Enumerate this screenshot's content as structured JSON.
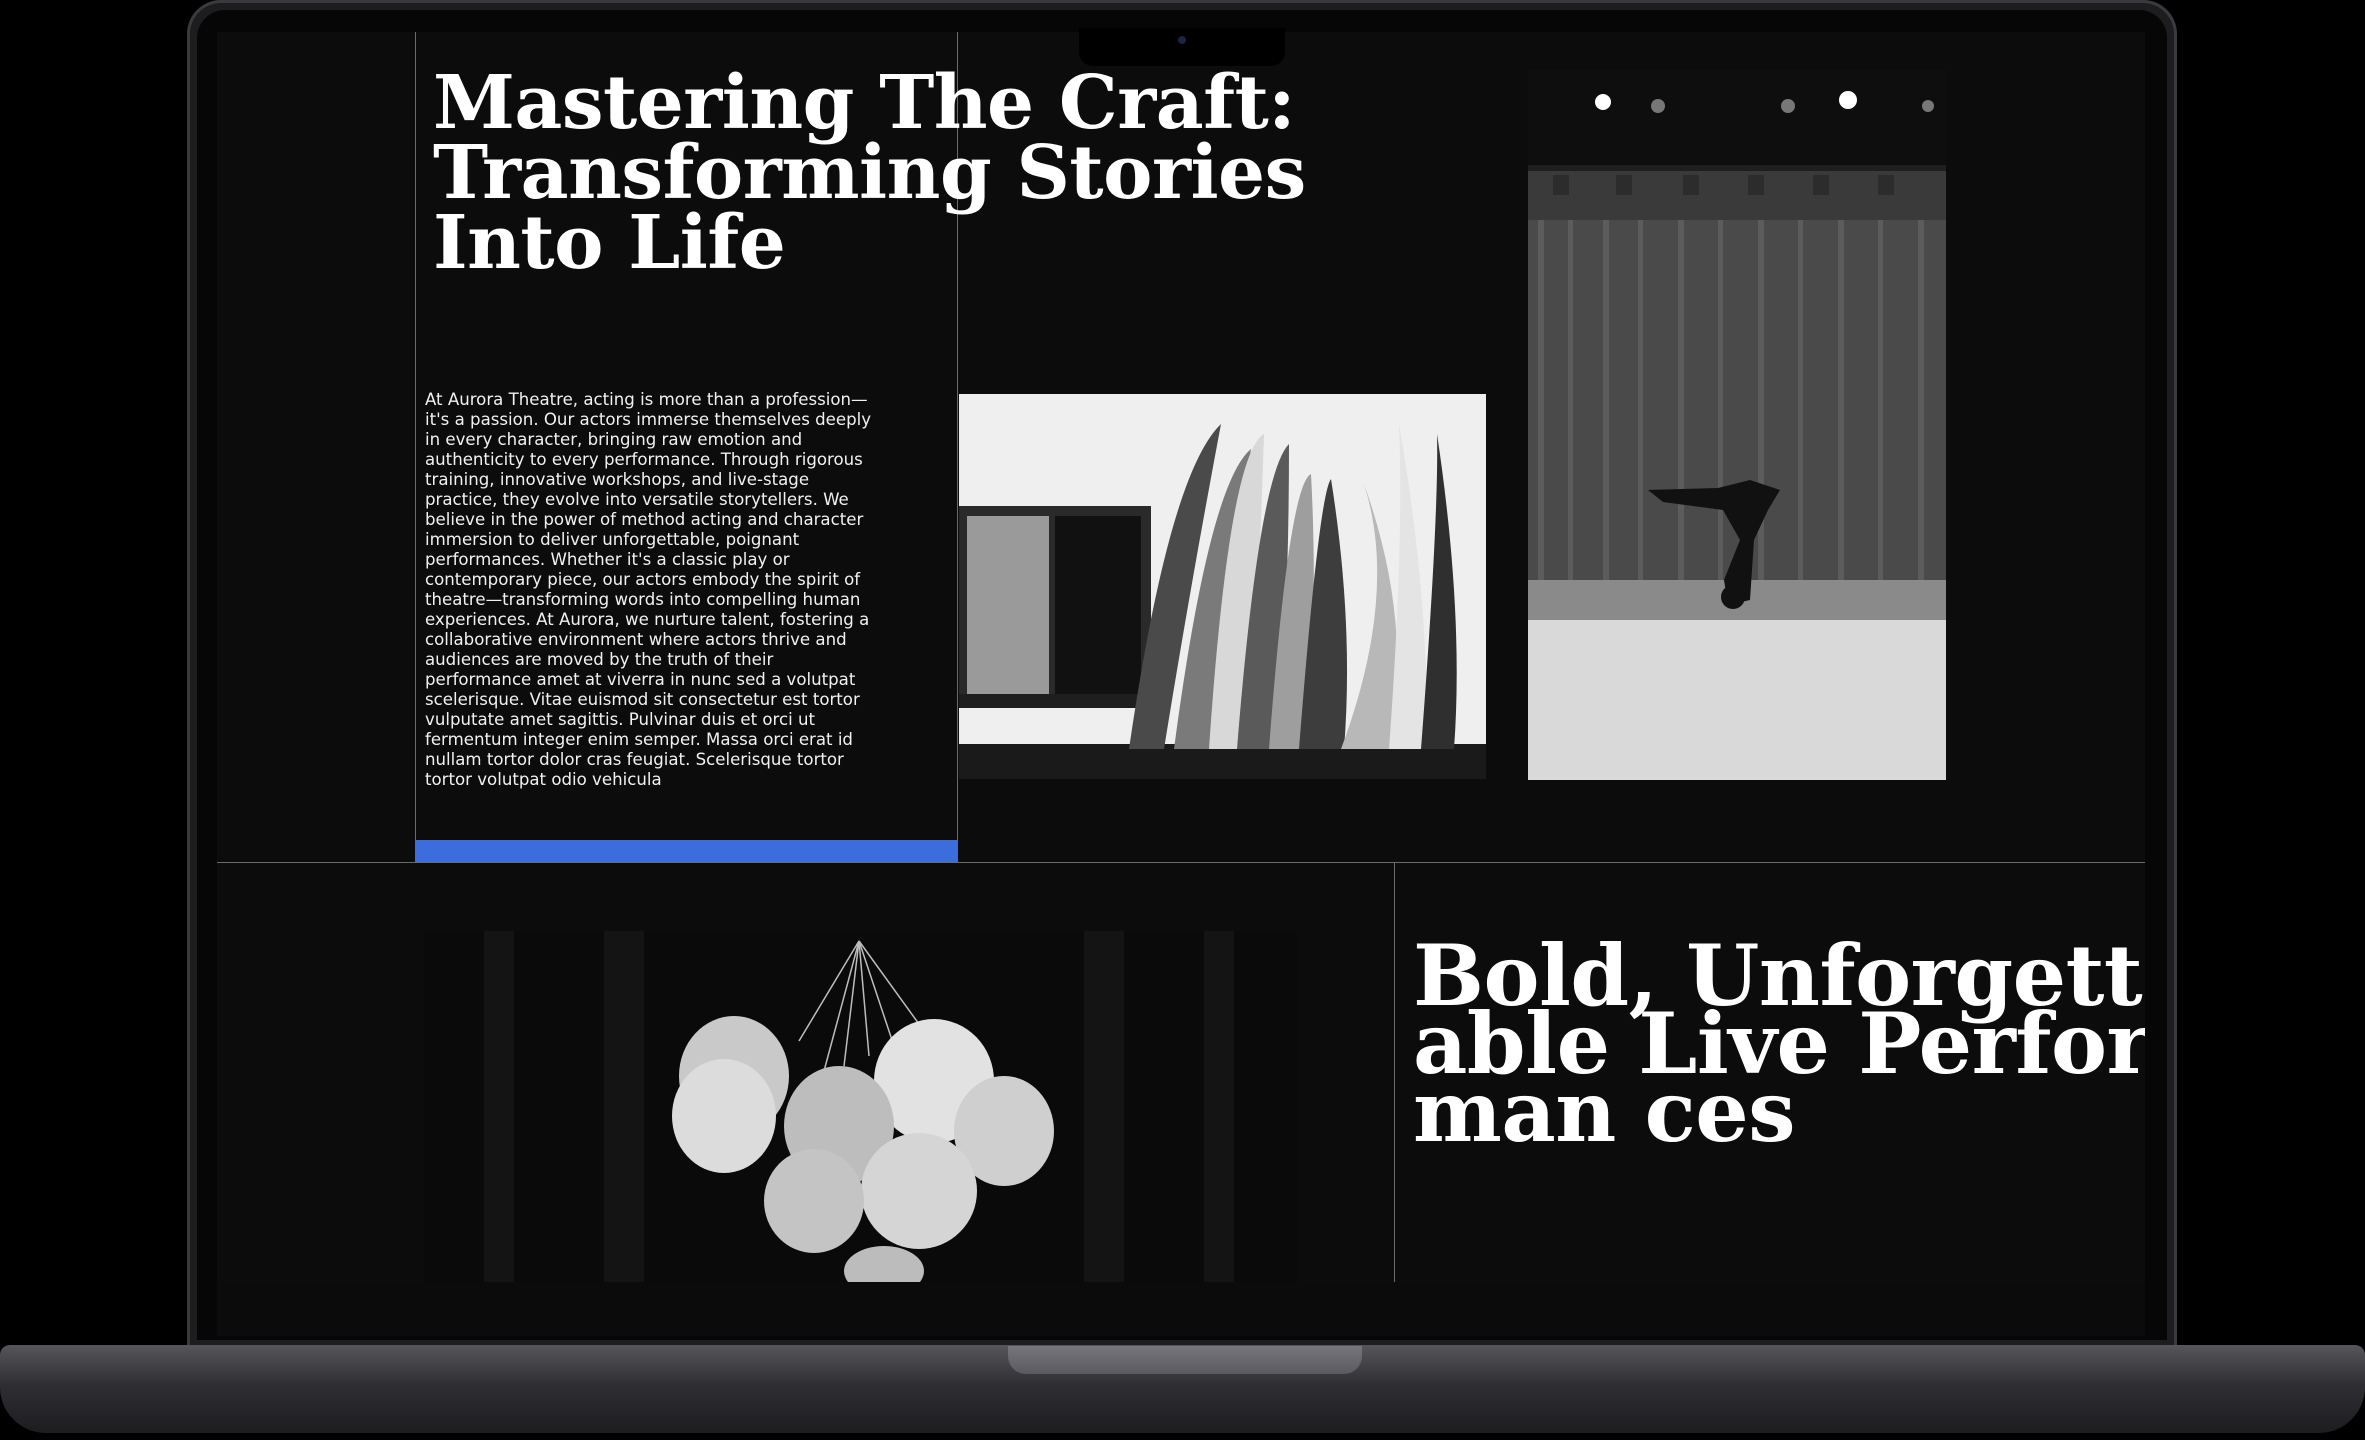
{
  "hero": {
    "title": "Mastering The Craft: Transforming Stories Into Life",
    "body": "At Aurora Theatre, acting is more than a profession—it's a passion. Our actors immerse themselves deeply in every character, bringing raw emotion and authenticity to every performance. Through rigorous training, innovative workshops, and live-stage practice, they evolve into versatile storytellers. We believe in the power of method acting and character immersion to deliver unforgettable, poignant performances. Whether it's a classic play or contemporary piece, our actors embody the spirit of theatre—transforming words into compelling human experiences. At Aurora, we nurture talent, fostering a collaborative environment where actors thrive and audiences are moved by the truth of their performance amet at viverra in nunc sed a volutpat scelerisque. Vitae euismod sit consectetur est tortor vulputate amet sagittis. Pulvinar duis et orci ut fermentum integer enim semper. Massa orci erat id nullam tortor dolor cras feugiat. Scelerisque tortor tortor volutpat odio vehicula"
  },
  "performances": {
    "title": "Bold, Unforgettable Live Performan ces"
  },
  "colors": {
    "background": "#0c0c0c",
    "accent": "#3b6edc",
    "divider": "#6b6b6b",
    "text": "#ffffff"
  }
}
